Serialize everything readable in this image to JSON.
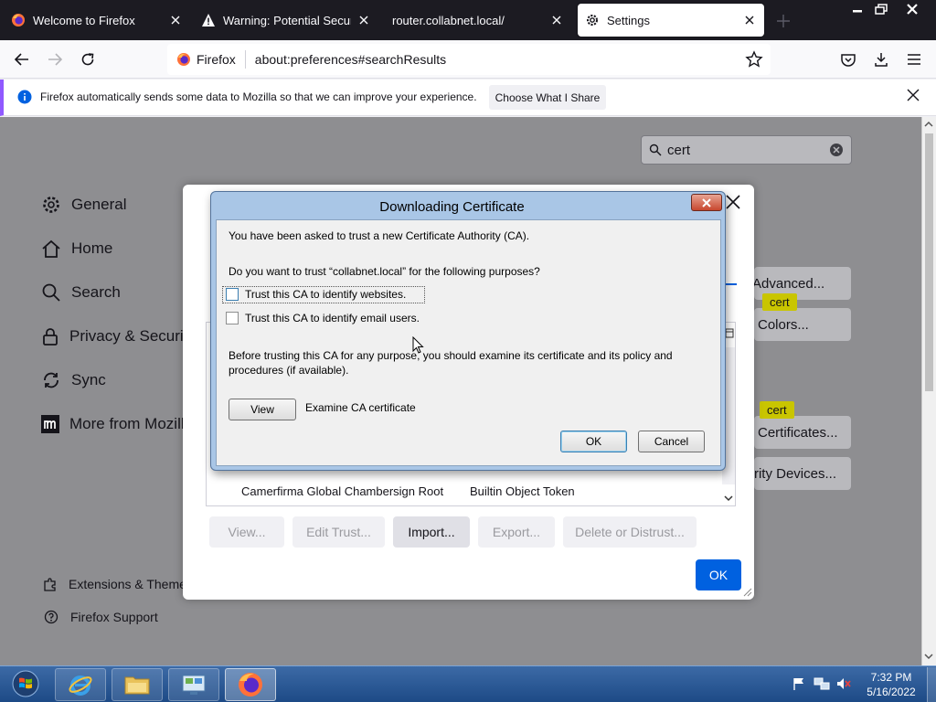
{
  "tabs": [
    {
      "title": "Welcome to Firefox",
      "icon": "firefox-icon"
    },
    {
      "title": "Warning: Potential Security Risk Ahead",
      "icon": "warning-icon"
    },
    {
      "title": "router.collabnet.local/",
      "icon": ""
    },
    {
      "title": "Settings",
      "icon": "gear-icon",
      "active": true
    }
  ],
  "urlbar": {
    "identity": "Firefox",
    "url": "about:preferences#searchResults"
  },
  "notification": {
    "text": "Firefox automatically sends some data to Mozilla so that we can improve your experience.",
    "button": "Choose What I Share"
  },
  "search": {
    "value": "cert"
  },
  "sidebar": {
    "items": [
      {
        "label": "General",
        "icon": "gear-icon"
      },
      {
        "label": "Home",
        "icon": "home-icon"
      },
      {
        "label": "Search",
        "icon": "search-icon"
      },
      {
        "label": "Privacy & Security",
        "icon": "lock-icon"
      },
      {
        "label": "Sync",
        "icon": "sync-icon"
      },
      {
        "label": "More from Mozilla",
        "icon": "mozilla-icon"
      }
    ],
    "footer": [
      {
        "label": "Extensions & Themes",
        "icon": "puzzle-icon"
      },
      {
        "label": "Firefox Support",
        "icon": "help-icon"
      }
    ]
  },
  "background_buttons": {
    "advanced": "Advanced...",
    "colors": "Colors...",
    "certificates": "Certificates...",
    "security_devices": "Security Devices...",
    "highlight": "cert"
  },
  "cert_manager": {
    "row": {
      "name": "Camerfirma Global Chambersign Root",
      "token": "Builtin Object Token"
    },
    "buttons": {
      "view": "View...",
      "edit_trust": "Edit Trust...",
      "import": "Import...",
      "export": "Export...",
      "delete": "Delete or Distrust..."
    },
    "ok": "OK"
  },
  "download_dialog": {
    "title": "Downloading Certificate",
    "intro": "You have been asked to trust a new Certificate Authority (CA).",
    "question": "Do you want to trust “collabnet.local” for the following purposes?",
    "options": [
      {
        "label": "Trust this CA to identify websites.",
        "checked": false
      },
      {
        "label": "Trust this CA to identify email users.",
        "checked": false
      }
    ],
    "warning": "Before trusting this CA for any purpose, you should examine its certificate and its policy and procedures (if available).",
    "view_button": "View",
    "view_desc": "Examine CA certificate",
    "ok": "OK",
    "cancel": "Cancel"
  },
  "taskbar": {
    "time": "7:32 PM",
    "date": "5/16/2022"
  },
  "colors": {
    "accent": "#0061e0",
    "highlight": "#c9c500",
    "notice_bar": "#9059ff"
  }
}
